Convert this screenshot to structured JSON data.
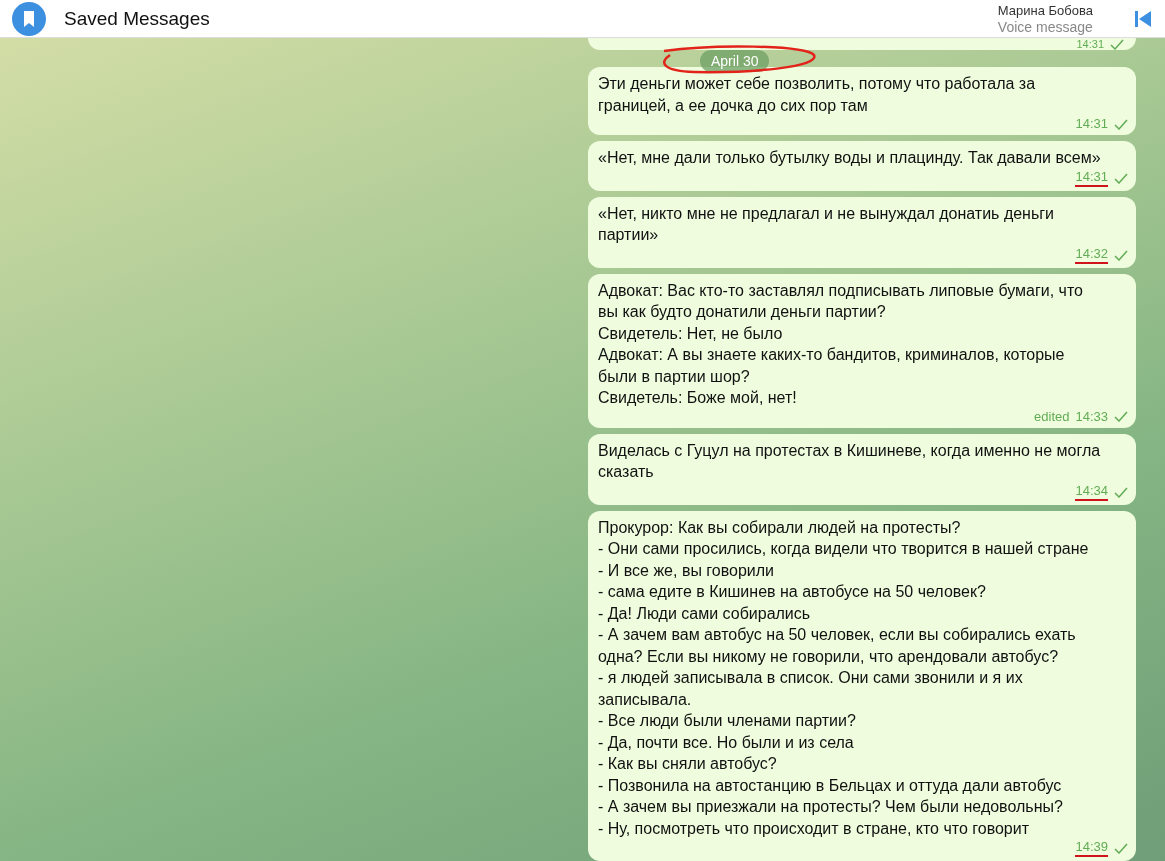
{
  "header": {
    "title": "Saved Messages",
    "player": {
      "name": "Марина Бобова",
      "subtitle": "Voice message"
    }
  },
  "partial_message": {
    "time": "14:31"
  },
  "date_pill": {
    "label": "April 30",
    "circled": true
  },
  "messages": [
    {
      "text": "Эти деньги может себе позволить, потому что работала за границей, а ее дочка до сих пор там",
      "time": "14:31",
      "underlined": false
    },
    {
      "text": "«Нет, мне дали только бутылку воды и плацинду. Так давали всем»",
      "time": "14:31",
      "underlined": true
    },
    {
      "text": "«Нет, никто мне не предлагал и не вынуждал донатиь деньги партии»",
      "time": "14:32",
      "underlined": true
    },
    {
      "text": "Адвокат: Вас кто-то заставлял подписывать липовые бумаги, что вы как будто донатили деньги партии?\nСвидетель: Нет, не было\nАдвокат: А вы знаете каких-то бандитов, криминалов, которые были в партии шор?\nСвидетель: Боже мой, нет!",
      "time": "14:33",
      "edited_label": "edited",
      "underlined": false
    },
    {
      "text": "Виделась с Гуцул на протестах в Кишиневе, когда именно не могла сказать",
      "time": "14:34",
      "underlined": true
    },
    {
      "text": "Прокурор: Как вы собирали людей на протесты?\n- Они сами просились, когда видели что творится в нашей стране\n- И все же, вы говорили\n- сама едите в Кишинев на автобусе на 50 человек?\n- Да! Люди сами собирались\n- А зачем вам автобус на 50 человек, если вы собирались ехать одна? Если вы никому не говорили, что арендовали автобус?\n- я людей записывала в список. Они сами звонили и я их записывала.\n- Все люди были членами партии?\n- Да, почти все. Но были и из села\n- Как вы сняли автобус?\n- Позвонила на автостанцию в Бельцах и оттуда дали автобус\n- А зачем вы приезжали на протесты? Чем были недовольны?\n- Ну, посмотреть что происходит в стране, кто что говорит",
      "time": "14:39",
      "underlined": true
    }
  ]
}
